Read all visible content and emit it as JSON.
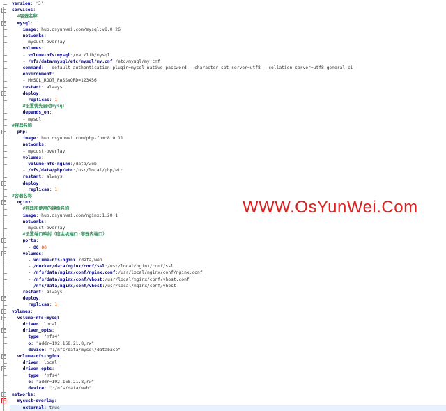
{
  "editor": {
    "lines": [
      {
        "indent": 0,
        "key": "version",
        "value": "'3'"
      },
      {
        "indent": 0,
        "key": "services",
        "value": ""
      },
      {
        "indent": 2,
        "comment": "#容器名称"
      },
      {
        "indent": 2,
        "key": "mysql",
        "value": ""
      },
      {
        "indent": 4,
        "key": "image",
        "value": "hub.osyunwei.com/mysql:v8.0.26"
      },
      {
        "indent": 4,
        "key": "networks",
        "value": ""
      },
      {
        "indent": 4,
        "dash": true,
        "value": "mycust-overlay"
      },
      {
        "indent": 4,
        "key": "volumes",
        "value": ""
      },
      {
        "indent": 4,
        "dash": true,
        "key": "volume-nfs-mysql",
        "value": "/var/lib/mysql"
      },
      {
        "indent": 4,
        "dash": true,
        "key": "/nfs/data/mysql/etc/mysql/my.cnf",
        "value": "/etc/mysql/my.cnf"
      },
      {
        "indent": 4,
        "key": "command",
        "value": "--default-authentication-plugin=mysql_native_password --character-set-server=utf8 --collation-server=utf8_general_ci"
      },
      {
        "indent": 4,
        "key": "environment",
        "value": ""
      },
      {
        "indent": 4,
        "dash": true,
        "value": "MYSQL_ROOT_PASSWORD=123456"
      },
      {
        "indent": 4,
        "key": "restart",
        "value": "always"
      },
      {
        "indent": 4,
        "key": "deploy",
        "value": ""
      },
      {
        "indent": 6,
        "key": "replicas",
        "value": "1",
        "num": true
      },
      {
        "indent": 4,
        "comment": "#设置优先启动mysql"
      },
      {
        "indent": 4,
        "key": "depends_on",
        "value": ""
      },
      {
        "indent": 4,
        "dash": true,
        "value": "mysql"
      },
      {
        "indent": 0,
        "comment": "#容器名称"
      },
      {
        "indent": 2,
        "key": "php",
        "value": ""
      },
      {
        "indent": 4,
        "key": "image",
        "value": "hub.osyunwei.com/php-fpm:8.0.11"
      },
      {
        "indent": 4,
        "key": "networks",
        "value": ""
      },
      {
        "indent": 4,
        "dash": true,
        "value": "mycust-overlay"
      },
      {
        "indent": 4,
        "key": "volumes",
        "value": ""
      },
      {
        "indent": 4,
        "dash": true,
        "key": "volume-nfs-nginx",
        "value": "/data/web"
      },
      {
        "indent": 4,
        "dash": true,
        "key": "/nfs/data/php/etc",
        "value": "/usr/local/php/etc"
      },
      {
        "indent": 4,
        "key": "restart",
        "value": "always"
      },
      {
        "indent": 4,
        "key": "deploy",
        "value": ""
      },
      {
        "indent": 6,
        "key": "replicas",
        "value": "1",
        "num": true
      },
      {
        "indent": 0,
        "comment": "#容器名称"
      },
      {
        "indent": 2,
        "key": "nginx",
        "value": ""
      },
      {
        "indent": 4,
        "comment": "#容器所使用的镜像名称"
      },
      {
        "indent": 4,
        "key": "image",
        "value": "hub.osyunwei.com/nginx:1.20.1"
      },
      {
        "indent": 4,
        "key": "networks",
        "value": ""
      },
      {
        "indent": 4,
        "dash": true,
        "value": "mycust-overlay"
      },
      {
        "indent": 4,
        "comment": "#设置端口映射（宿主机端口:容器内端口）"
      },
      {
        "indent": 4,
        "key": "ports",
        "value": ""
      },
      {
        "indent": 6,
        "dash": true,
        "key": "80",
        "value": "80",
        "num": true
      },
      {
        "indent": 4,
        "key": "volumes",
        "value": ""
      },
      {
        "indent": 6,
        "dash": true,
        "key": "volume-nfs-nginx",
        "value": "/data/web"
      },
      {
        "indent": 6,
        "dash": true,
        "key": "/docker/data/nginx/conf/ssl",
        "value": "/usr/local/nginx/conf/ssl"
      },
      {
        "indent": 6,
        "dash": true,
        "key": "/nfs/data/nginx/conf/nginx.conf",
        "value": "/usr/local/nginx/conf/nginx.conf"
      },
      {
        "indent": 6,
        "dash": true,
        "key": "/nfs/data/nginx/conf/vhost",
        "value": "/usr/local/nginx/conf/vhost.conf"
      },
      {
        "indent": 6,
        "dash": true,
        "key": "/nfs/data/nginx/conf/vhost",
        "value": "/usr/local/nginx/conf/vhost"
      },
      {
        "indent": 4,
        "key": "restart",
        "value": "always"
      },
      {
        "indent": 4,
        "key": "deploy",
        "value": ""
      },
      {
        "indent": 6,
        "key": "replicas",
        "value": "1",
        "num": true
      },
      {
        "indent": 0,
        "key": "volumes",
        "value": ""
      },
      {
        "indent": 2,
        "key": "volume-nfs-mysql",
        "value": ""
      },
      {
        "indent": 4,
        "key": "driver",
        "value": "local"
      },
      {
        "indent": 4,
        "key": "driver_opts",
        "value": ""
      },
      {
        "indent": 6,
        "key": "type",
        "value": "\"nfs4\""
      },
      {
        "indent": 6,
        "key": "o",
        "value": "\"addr=192.168.21.8,rw\""
      },
      {
        "indent": 6,
        "key": "device",
        "value": "\":/nfs/data/mysql/database\""
      },
      {
        "indent": 2,
        "key": "volume-nfs-nginx",
        "value": ""
      },
      {
        "indent": 4,
        "key": "driver",
        "value": "local"
      },
      {
        "indent": 4,
        "key": "driver_opts",
        "value": ""
      },
      {
        "indent": 6,
        "key": "type",
        "value": "\"nfs4\""
      },
      {
        "indent": 6,
        "key": "o",
        "value": "\"addr=192.168.21.8,rw\""
      },
      {
        "indent": 6,
        "key": "device",
        "value": "\":/nfs/data/web\""
      },
      {
        "indent": 0,
        "key": "networks",
        "value": ""
      },
      {
        "indent": 2,
        "key": "mycust-overlay",
        "value": ""
      },
      {
        "indent": 4,
        "key": "external",
        "value": "true",
        "highlight": true
      }
    ]
  },
  "watermark": {
    "text": "WWW.OsYunWei.Com",
    "color": "#e02020"
  },
  "colors": {
    "key": "#000080",
    "comment": "#2e8b57",
    "number": "#cc4400",
    "highlight": "#e8f2fe"
  },
  "icons": {
    "fold": "fold-collapse-icon"
  }
}
